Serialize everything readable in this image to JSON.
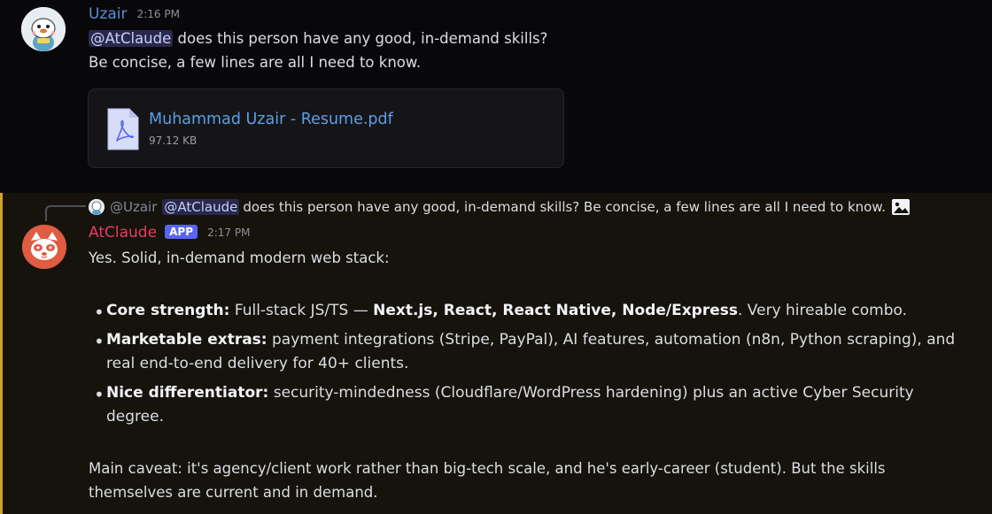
{
  "msg1": {
    "username": "Uzair",
    "time": "2:16 PM",
    "mention": "@AtClaude",
    "line1_rest": " does this person have any good, in-demand skills?",
    "line2": "Be concise, a few lines are all I need to know.",
    "attachment": {
      "filename": "Muhammad Uzair - Resume.pdf",
      "size": "97.12 KB"
    }
  },
  "msg2": {
    "reply": {
      "user": "@Uzair",
      "mention": "@AtClaude",
      "text": "does this person have any good, in-demand skills? Be concise, a few lines are all I need to know."
    },
    "username": "AtClaude",
    "badge": "APP",
    "time": "2:17 PM",
    "intro": "Yes. Solid, in-demand modern web stack:",
    "bullets": [
      {
        "label": "Core strength:",
        "text_a": " Full-stack JS/TS — ",
        "bold": "Next.js, React, React Native, Node/Express",
        "text_b": ". Very hireable combo."
      },
      {
        "label": "Marketable extras:",
        "line1": " payment integrations (Stripe, PayPal), AI features, automation (n8n, Python scraping), and",
        "line2": "real end-to-end delivery for 40+ clients."
      },
      {
        "label": "Nice differentiator:",
        "line1": " security-mindedness (Cloudflare/WordPress hardening) plus an active Cyber Security",
        "line2": "degree."
      }
    ],
    "caveat_line1": "Main caveat: it's agency/client work rather than big-tech scale, and he's early-career (student). But the skills",
    "caveat_line2": "themselves are current and in demand."
  },
  "colors": {
    "mention_bg": "#28294b",
    "link": "#5b9fe8",
    "bot_name": "#e63e60",
    "app_badge": "#5865f2",
    "highlight_border": "#d2a22d"
  }
}
